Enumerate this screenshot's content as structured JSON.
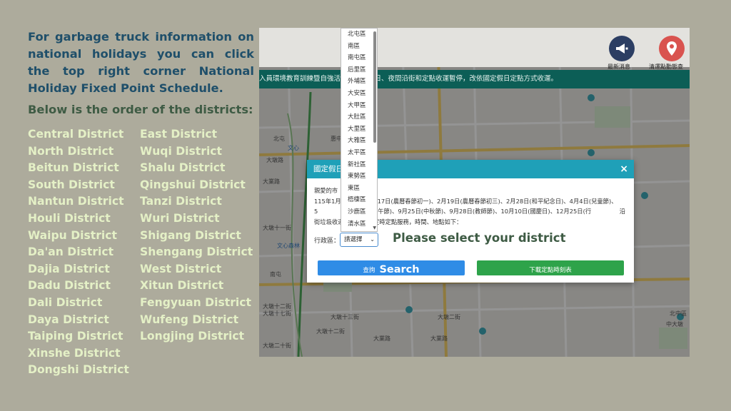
{
  "instructions": {
    "intro": "For garbage truck information on national holidays you can click the top right corner National Holiday Fixed Point Schedule.",
    "order_heading": "Below is the order of the districts:",
    "districts_col1": [
      "Central District",
      "North District",
      "Beitun District",
      "South District",
      "Nantun District",
      "Houli District",
      "Waipu District",
      "Da'an District",
      "Dajia District",
      "Dadu District",
      "Dali District",
      "Daya District",
      "Taiping District",
      "Xinshe District",
      "Dongshi District"
    ],
    "districts_col2": [
      "East District",
      "Wuqi District",
      "Shalu District",
      "Qingshui District",
      "Tanzi District",
      "Wuri District",
      "Shigang District",
      "Shengang District",
      "West District",
      "Xitun District",
      "Fengyuan District",
      "Wufeng District",
      "Longjing District"
    ]
  },
  "app": {
    "topbar": {
      "news_label": "最新消息",
      "location_label": "清運點動態查"
    },
    "marquee": "入員環境教育訓練暨自強活動，夜間及日、夜間沿街和定點收運暫停，改依國定假日定點方式收運。",
    "map_labels": {
      "l1": "北屯",
      "l2": "文心",
      "l3": "大墩路",
      "l4": "大業路",
      "l5": "南屯",
      "l6": "惠中路",
      "l7": "黎明",
      "l8": "大墩十一街",
      "l9": "大墩十二街",
      "l10": "大墩十七街",
      "l11": "大墩十二街",
      "l12": "大墩十三街",
      "l13": "大墩二十街",
      "l14": "文心森林",
      "l15": "大業路",
      "l16": "大業路",
      "l17": "大墩二街",
      "l18": "北中區",
      "l19": "中大墩"
    },
    "modal": {
      "title": "國定假日",
      "close": "×",
      "body_line1": "親愛的市",
      "body_line2": "115年1月",
      "body_segment": "，2月17日(農曆春節初一)、2月19日(農曆春節初三)、2月28日(和平紀念日)、4月4日(兒童節)、5",
      "body_line3": "、6月19日(端午節)、9月25日(中秋節)、9月28日(教師節)、10月10日(國慶日)、12月25日(行",
      "body_line4": "沿街垃圾收運，當天改為定時定點服務，時間、地點如下：",
      "district_label": "行政區：",
      "select_value": "請選擇",
      "annotation_select": "Please select your district",
      "search_zh": "查詢",
      "search_en": "Search",
      "download_label": "下載定點時刻表"
    },
    "dropdown_options": [
      "北屯區",
      "南區",
      "南屯區",
      "后里區",
      "外埔區",
      "大安區",
      "大甲區",
      "大肚區",
      "大里區",
      "大雅區",
      "太平區",
      "新社區",
      "東勢區",
      "東區",
      "梧棲區",
      "沙鹿區",
      "清水區"
    ]
  },
  "colors": {
    "background": "#adab9c",
    "intro_text": "#1f4f6a",
    "heading_text": "#3e5b44",
    "district_text": "#e4f0c6",
    "modal_header": "#1fa0b8",
    "search_button": "#2f8ce6",
    "download_button": "#2ea34a",
    "marquee": "#0c5e56"
  }
}
